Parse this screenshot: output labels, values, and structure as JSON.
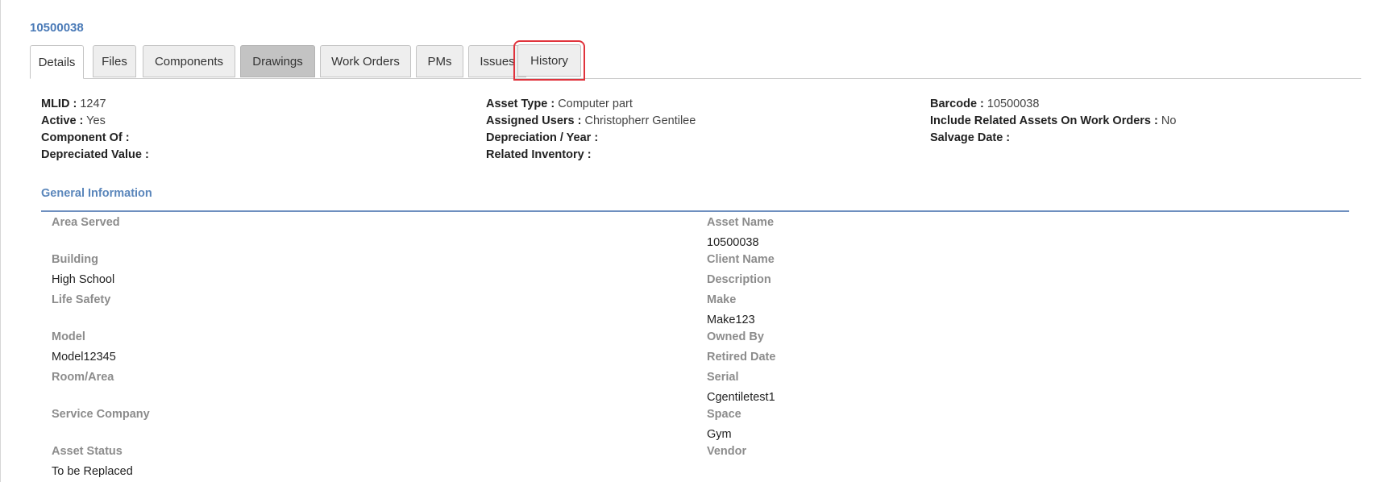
{
  "asset": {
    "id": "10500038"
  },
  "tabs": [
    {
      "label": "Details"
    },
    {
      "label": "Files"
    },
    {
      "label": "Components"
    },
    {
      "label": "Drawings"
    },
    {
      "label": "Work Orders"
    },
    {
      "label": "PMs"
    },
    {
      "label": "Issues"
    },
    {
      "label": "History"
    }
  ],
  "summary": {
    "col1": [
      {
        "label": "MLID :",
        "value": "1247"
      },
      {
        "label": "Active :",
        "value": "Yes"
      },
      {
        "label": "Component Of :",
        "value": ""
      },
      {
        "label": "Depreciated Value :",
        "value": ""
      }
    ],
    "col2": [
      {
        "label": "Asset Type :",
        "value": "Computer part"
      },
      {
        "label": "Assigned Users :",
        "value": "Christopherr Gentilee"
      },
      {
        "label": "Depreciation / Year :",
        "value": ""
      },
      {
        "label": "Related Inventory :",
        "value": ""
      }
    ],
    "col3": [
      {
        "label": "Barcode :",
        "value": "10500038"
      },
      {
        "label": "Include Related Assets On Work Orders :",
        "value": "No"
      },
      {
        "label": "Salvage Date :",
        "value": ""
      }
    ]
  },
  "general": {
    "title": "General Information",
    "left": [
      {
        "label": "Area Served",
        "value": ""
      },
      {
        "label": "Building",
        "value": "High School"
      },
      {
        "label": "Life Safety",
        "value": ""
      },
      {
        "label": "Model",
        "value": "Model12345"
      },
      {
        "label": "Room/Area",
        "value": ""
      },
      {
        "label": "Service Company",
        "value": ""
      },
      {
        "label": "Asset Status",
        "value": "To be Replaced"
      }
    ],
    "right": [
      {
        "label": "Asset Name",
        "value": "10500038"
      },
      {
        "label": "Client Name",
        "value": ""
      },
      {
        "label": "Description",
        "value": ""
      },
      {
        "label": "Make",
        "value": "Make123"
      },
      {
        "label": "Owned By",
        "value": ""
      },
      {
        "label": "Retired Date",
        "value": ""
      },
      {
        "label": "Serial",
        "value": "Cgentiletest1"
      },
      {
        "label": "Space",
        "value": "Gym"
      },
      {
        "label": "Vendor",
        "value": ""
      }
    ]
  },
  "colors": {
    "accent": "#4a7ab7",
    "highlight": "#e0333c",
    "section_rule": "#6e8fbf"
  }
}
